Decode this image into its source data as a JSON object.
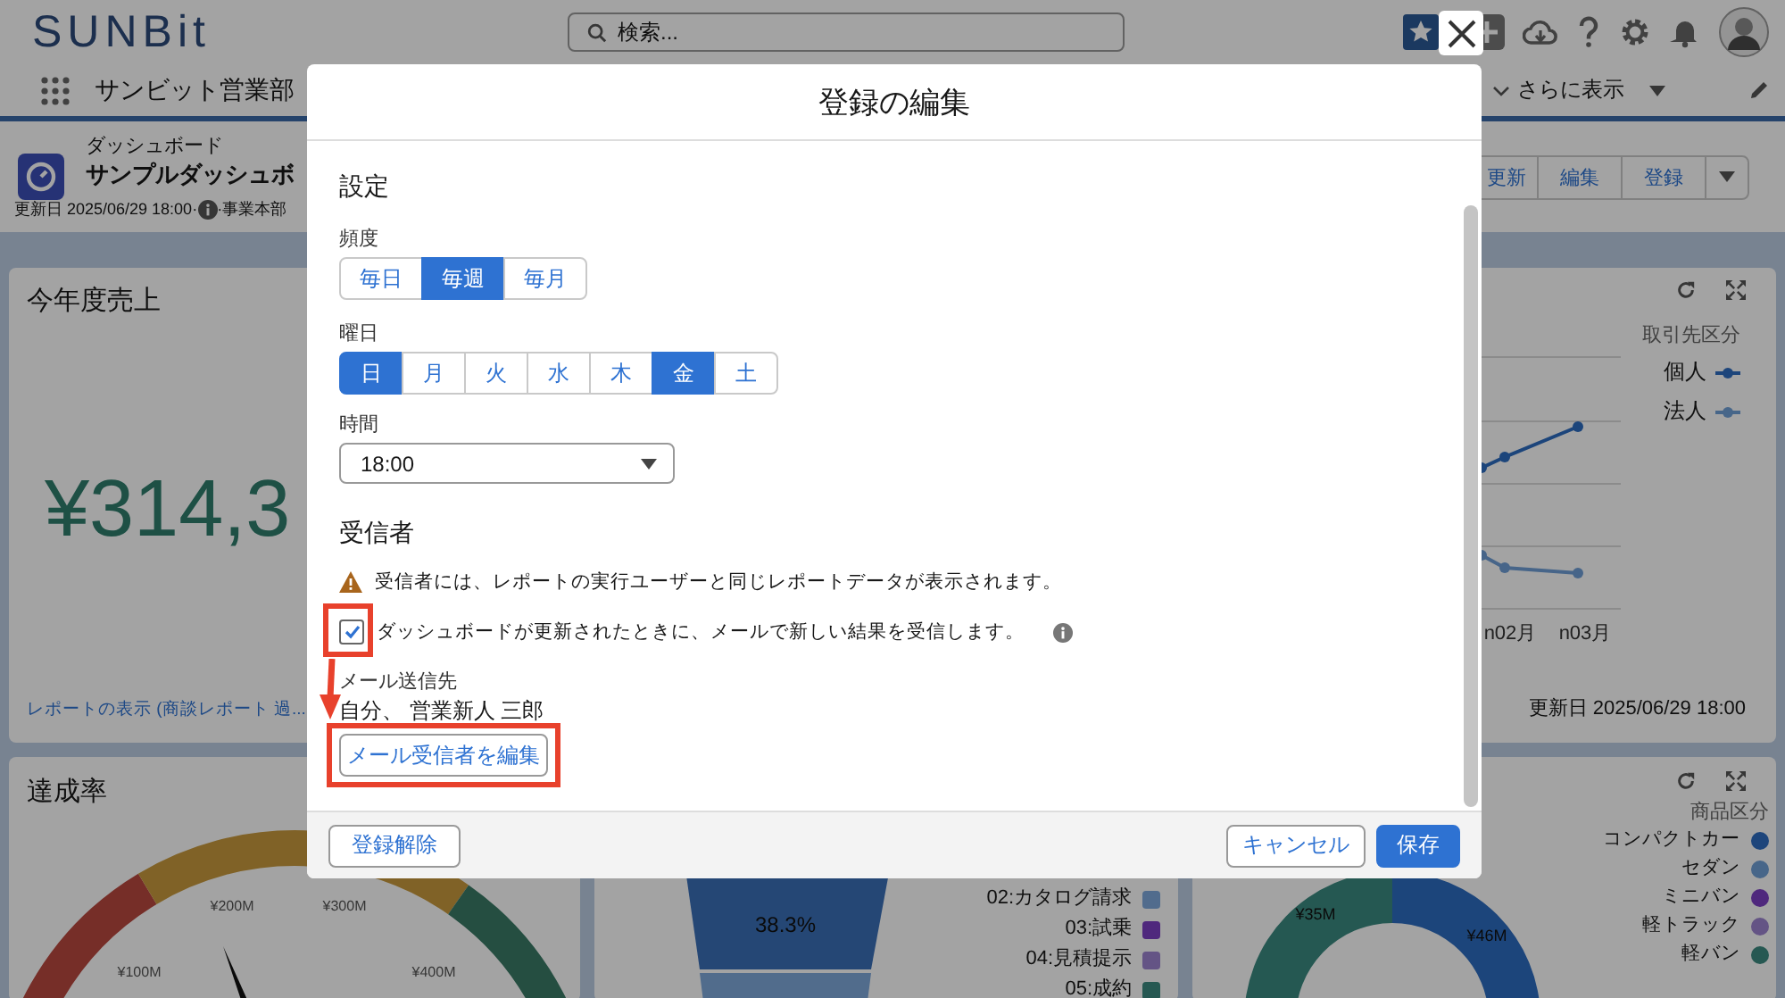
{
  "header": {
    "logo": "SUNBit",
    "search_placeholder": "検索..."
  },
  "nav": {
    "app_name": "サンビット営業部",
    "more": "さらに表示"
  },
  "dashboard": {
    "type_label": "ダッシュボード",
    "title": "サンプルダッシュボ",
    "updated": "更新日 2025/06/29 18:00·",
    "owner": "·事業本部",
    "buttons": [
      "更新",
      "編集",
      "登録"
    ]
  },
  "sales_card": {
    "title": "今年度売上",
    "value": "¥314,3",
    "link": "レポートの表示 (商談レポート 過..."
  },
  "trend_card": {
    "legend_title": "取引先区分",
    "legend": [
      {
        "label": "個人",
        "color": "#1d457b"
      },
      {
        "label": "法人",
        "color": "#476689"
      }
    ],
    "x_labels": [
      "n02月",
      "n03月"
    ],
    "updated": "更新日 2025/06/29 18:00"
  },
  "gauge_card": {
    "title": "達成率",
    "scale_labels": [
      "¥100M",
      "¥200M",
      "¥300M",
      "¥400M"
    ]
  },
  "funnel_card": {
    "stage_label": "38.3%",
    "legend": [
      {
        "label": "02:カタログ請求",
        "color": "#516c8d"
      },
      {
        "label": "03:試乗",
        "color": "#4f287d"
      },
      {
        "label": "04:見積提示",
        "color": "#645485"
      },
      {
        "label": "05:成約",
        "color": "#265852"
      }
    ]
  },
  "donut_card": {
    "legend_title": "商品区分",
    "slice_labels": [
      "¥35M",
      "¥46M"
    ],
    "legend": [
      {
        "label": "コンパクトカー",
        "color": "#1d457b"
      },
      {
        "label": "セダン",
        "color": "#476689"
      },
      {
        "label": "ミニバン",
        "color": "#4f287d"
      },
      {
        "label": "軽トラック",
        "color": "#645485"
      },
      {
        "label": "軽バン",
        "color": "#265852"
      }
    ]
  },
  "modal": {
    "title": "登録の編集",
    "settings_heading": "設定",
    "frequency": {
      "label": "頻度",
      "options": [
        {
          "label": "毎日",
          "selected": false
        },
        {
          "label": "毎週",
          "selected": true
        },
        {
          "label": "毎月",
          "selected": false
        }
      ]
    },
    "weekday": {
      "label": "曜日",
      "options": [
        {
          "label": "日",
          "selected": true
        },
        {
          "label": "月",
          "selected": false
        },
        {
          "label": "火",
          "selected": false
        },
        {
          "label": "水",
          "selected": false
        },
        {
          "label": "木",
          "selected": false
        },
        {
          "label": "金",
          "selected": true
        },
        {
          "label": "土",
          "selected": false
        }
      ]
    },
    "time": {
      "label": "時間",
      "value": "18:00"
    },
    "recipients_heading": "受信者",
    "warning": "受信者には、レポートの実行ユーザーと同じレポートデータが表示されます。",
    "email_option": {
      "label": "ダッシュボードが更新されたときに、メールで新しい結果を受信します。",
      "checked": true
    },
    "send_to_label": "メール送信先",
    "send_to": "自分、 営業新人 三郎",
    "edit_recipients": "メール受信者を編集",
    "unsubscribe": "登録解除",
    "cancel": "キャンセル",
    "save": "保存"
  }
}
